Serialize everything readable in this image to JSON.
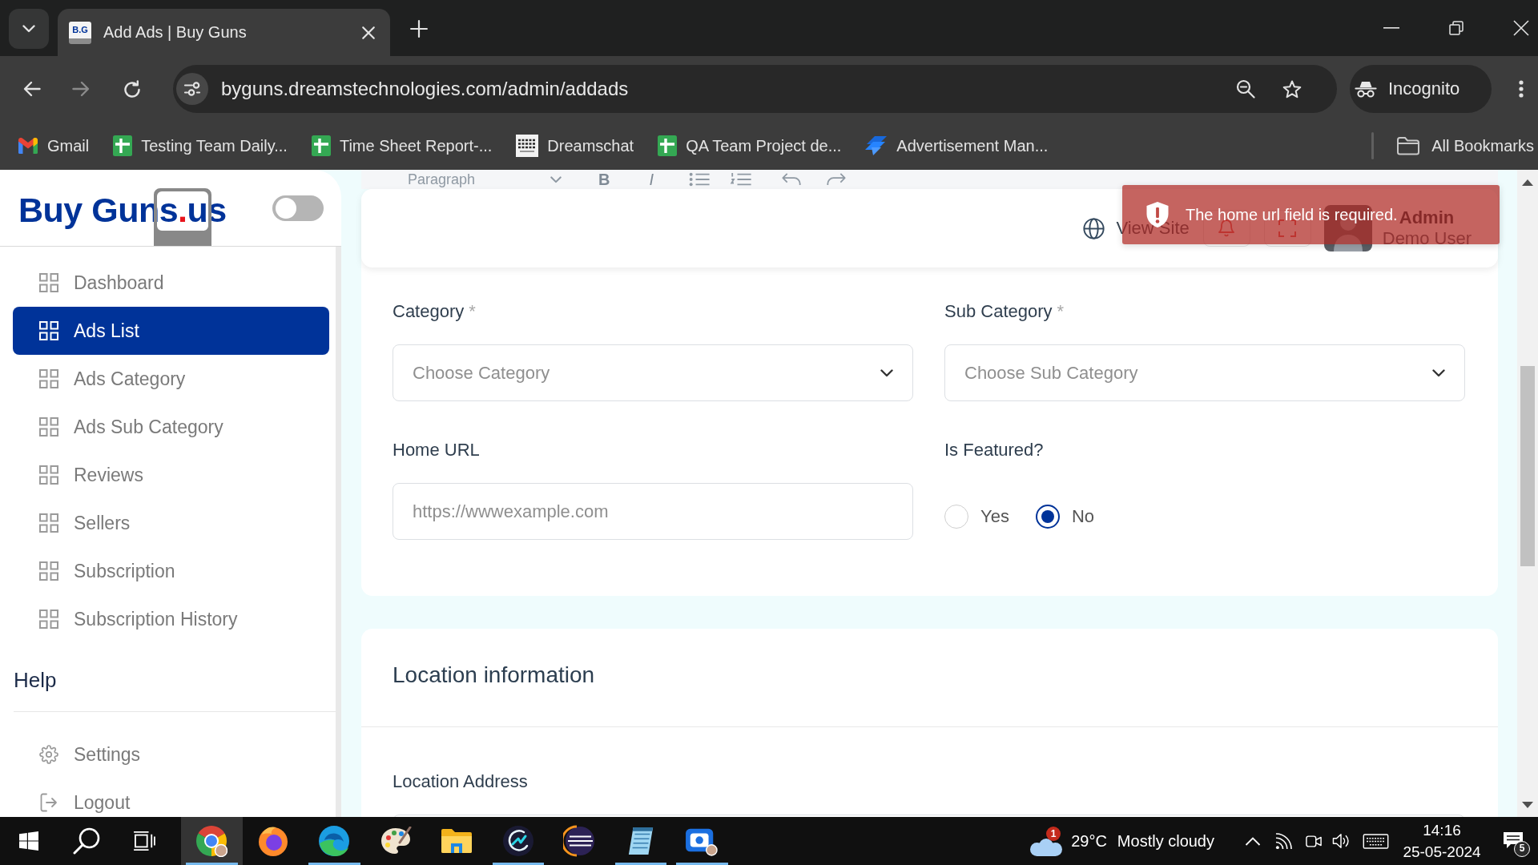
{
  "browser": {
    "tabs": [
      {
        "title": "Add Ads | Buy Guns",
        "favicon_text": "B.G",
        "selected": true
      }
    ],
    "address": "byguns.dreamstechnologies.com/admin/addads",
    "profile": "Incognito",
    "bookmarks": [
      {
        "label": "Gmail",
        "kind": "gmail"
      },
      {
        "label": "Testing Team Daily...",
        "kind": "sheets"
      },
      {
        "label": "Time Sheet Report-...",
        "kind": "sheets"
      },
      {
        "label": "Dreamschat",
        "kind": "dreams"
      },
      {
        "label": "QA Team Project de...",
        "kind": "sheets"
      },
      {
        "label": "Advertisement Man...",
        "kind": "jira"
      }
    ],
    "all_bookmarks": "All Bookmarks"
  },
  "sidebar": {
    "logo": [
      {
        "text": "Buy Guns",
        "color": "#003399"
      },
      {
        "text": ".",
        "color": "#e8141c"
      },
      {
        "text": "us",
        "color": "#003399"
      }
    ],
    "theme_toggle": {
      "on": false
    },
    "items": [
      {
        "label": "Dashboard",
        "selected": false
      },
      {
        "label": "Ads List",
        "selected": true
      },
      {
        "label": "Ads Category",
        "selected": false
      },
      {
        "label": "Ads Sub Category",
        "selected": false
      },
      {
        "label": "Reviews",
        "selected": false
      },
      {
        "label": "Sellers",
        "selected": false
      },
      {
        "label": "Subscription",
        "selected": false
      },
      {
        "label": "Subscription History",
        "selected": false
      }
    ],
    "help_heading": "Help",
    "footer_items": [
      {
        "label": "Settings",
        "kind": "settings"
      },
      {
        "label": "Logout",
        "kind": "logout"
      }
    ]
  },
  "editor_toolbar": {
    "format_label": "Paragraph",
    "style_buttons": [
      "B",
      "I"
    ]
  },
  "header": {
    "view_site": "View Site",
    "user_name": "Admin",
    "user_role": "Demo User"
  },
  "toast": {
    "message": "The home url field is required."
  },
  "form": {
    "fields": [
      {
        "kind": "select",
        "label": "Category",
        "required_mark": "*",
        "placeholder": "Choose Category"
      },
      {
        "kind": "select",
        "label": "Sub Category",
        "required_mark": "*",
        "placeholder": "Choose Sub Category"
      },
      {
        "kind": "input",
        "label": "Home URL",
        "placeholder": "https://wwwexample.com"
      },
      {
        "kind": "radio",
        "label": "Is Featured?",
        "options": [
          {
            "label": "Yes",
            "selected": false
          },
          {
            "label": "No",
            "selected": true
          }
        ]
      }
    ]
  },
  "location": {
    "title": "Location information",
    "fields": [
      {
        "kind": "input",
        "label": "Location Address"
      }
    ]
  },
  "taskbar": {
    "buttons": [
      {
        "kind": "start",
        "running": false,
        "selected": false
      },
      {
        "kind": "search",
        "running": false,
        "selected": false
      },
      {
        "kind": "taskview",
        "running": false,
        "selected": false
      },
      {
        "kind": "chrome",
        "running": true,
        "selected": true
      },
      {
        "kind": "firefox",
        "running": false,
        "selected": false
      },
      {
        "kind": "edge",
        "running": true,
        "selected": false
      },
      {
        "kind": "paint",
        "running": false,
        "selected": false
      },
      {
        "kind": "explorer",
        "running": false,
        "selected": false
      },
      {
        "kind": "arrow_app",
        "running": true,
        "selected": false
      },
      {
        "kind": "eclipse",
        "running": false,
        "selected": false
      },
      {
        "kind": "notepad",
        "running": true,
        "selected": false
      },
      {
        "kind": "meeting",
        "running": true,
        "selected": false
      }
    ],
    "weather": {
      "alert_count": "1",
      "temperature": "29°C",
      "condition": "Mostly cloudy"
    },
    "clock": {
      "time": "14:16",
      "date": "25-05-2024"
    },
    "notification_count": "5"
  }
}
